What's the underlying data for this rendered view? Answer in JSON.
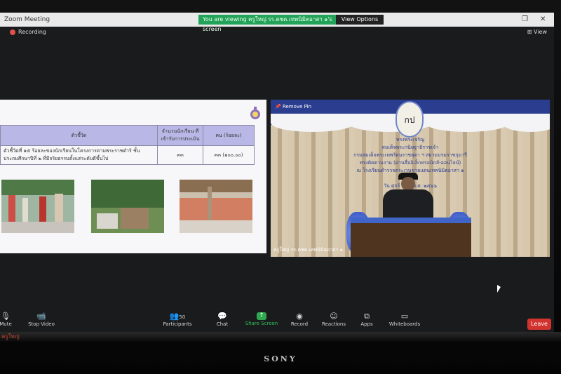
{
  "window": {
    "title": "Zoom Meeting",
    "restore_icon": "restore-icon",
    "close_icon": "close-icon"
  },
  "banner": {
    "viewing_text": "You are viewing ครูใหญ่ รร.ตชด.เทพนิมิตอาสา ๑'s screen",
    "view_options": "View Options"
  },
  "recording": {
    "label": "Recording",
    "view_label": "View"
  },
  "slide": {
    "table": {
      "headers": [
        "ตัวชี้วัด",
        "จำนวนนักเรียน ที่เข้ารับการประเมิน",
        "คน (ร้อยละ)"
      ],
      "rows": [
        [
          "ตัวชี้วัดที่ ๑๕ ร้อยละของนักเรียนในโครงการตามพระราชดำริ ชั้นประถมศึกษาปีที่ ๒ ที่มีจริยธรรมตั้งแต่ระดับดีขึ้นไป",
          "๓๓",
          "๓๓ (๑๐๐.๐๐)"
        ]
      ]
    }
  },
  "video": {
    "remove_pin": "Remove Pin",
    "crest_text": "กป",
    "banner_lines": [
      "ทรงพระเจริญ",
      "สมเด็จพระกนิษฐาธิราชเจ้า",
      "กรมสมเด็จพระเทพรัตนราชสุดา ฯ สยามบรมราชกุมารี",
      "ทรงติดตามงาน (ผ่านสื่ออิเล็กทรอนิกส์-ออนไลน์)",
      "ณ โรงเรียนตำรวจตระเวนชายแดนเทพนิมิตอาสา ๑",
      "วันที่ ...",
      "วัน ศุกร์ ที่ ... พ.ศ. ๒๕๖๖"
    ],
    "name_tag": "ครูใหญ่ รร.ตชด.เทพนิมิตอาสา ๑"
  },
  "toolbar": {
    "items": [
      {
        "label": "Mute",
        "icon": "microphone-icon"
      },
      {
        "label": "Stop Video",
        "icon": "video-camera-icon"
      },
      {
        "label": "Participants",
        "icon": "participants-icon",
        "count": "50"
      },
      {
        "label": "Chat",
        "icon": "chat-icon"
      },
      {
        "label": "Share Screen",
        "icon": "share-screen-icon"
      },
      {
        "label": "Record",
        "icon": "record-icon"
      },
      {
        "label": "Reactions",
        "icon": "reactions-icon"
      },
      {
        "label": "Apps",
        "icon": "apps-icon"
      },
      {
        "label": "Whiteboards",
        "icon": "whiteboard-icon"
      }
    ],
    "leave": "Leave"
  },
  "monitor": {
    "brand": "SONY",
    "reflection": "ครูใหญ่"
  },
  "colors": {
    "share_green": "#2fa84f",
    "leave_red": "#d2332f",
    "banner_green": "#23a35a"
  }
}
